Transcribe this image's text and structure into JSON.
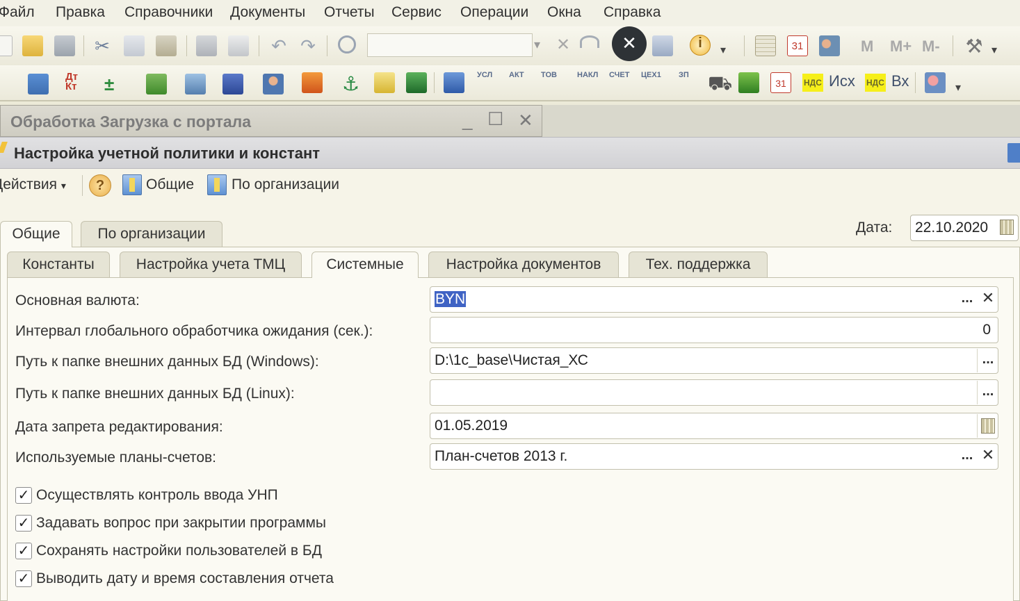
{
  "menu": [
    "Файл",
    "Правка",
    "Справочники",
    "Документы",
    "Отчеты",
    "Сервис",
    "Операции",
    "Окна",
    "Справка"
  ],
  "toolbar": {
    "memory_buttons": [
      "M",
      "M+",
      "M-"
    ],
    "doc_buttons": [
      "УСЛ",
      "АКТ",
      "ТОВ",
      "НАКЛ",
      "СЧЕТ",
      "ЦЕХ1",
      "ЗП"
    ],
    "nds_label": "НДС",
    "nds_out": "Исх",
    "nds_in": "Вх"
  },
  "docwin": {
    "title": "Обработка  Загрузка с портала"
  },
  "form": {
    "title": "Настройка учетной политики и констант",
    "actions_label": "Действия",
    "general_label": "Общие",
    "by_org_label": "По организации",
    "date_label": "Дата:",
    "date_value": "22.10.2020",
    "top_tabs": [
      "Общие",
      "По организации"
    ],
    "sub_tabs": [
      "Константы",
      "Настройка учета ТМЦ",
      "Системные",
      "Настройка документов",
      "Тех. поддержка"
    ]
  },
  "fields": {
    "currency": {
      "label": "Основная валюта:",
      "value": "BYN"
    },
    "interval": {
      "label": "Интервал глобального обработчика ожидания (сек.):",
      "value": "0"
    },
    "path_windows": {
      "label": "Путь к папке внешних данных БД (Windows):",
      "value": "D:\\1c_base\\Чистая_ХС"
    },
    "path_linux": {
      "label": "Путь к папке внешних данных БД (Linux):",
      "value": ""
    },
    "edit_ban_date": {
      "label": "Дата запрета редактирования:",
      "value": "01.05.2019"
    },
    "charts_of_accounts": {
      "label": "Используемые планы-счетов:",
      "value": "План-счетов 2013 г."
    }
  },
  "checkboxes": [
    {
      "label": "Осуществлять контроль ввода УНП",
      "checked": true
    },
    {
      "label": "Задавать вопрос при закрытии программы",
      "checked": true
    },
    {
      "label": "Сохранять настройки пользователей в БД",
      "checked": true
    },
    {
      "label": "Выводить дату и время составления отчета",
      "checked": true
    }
  ],
  "ui": {
    "ellipsis": "...",
    "clear": "✕",
    "close_overlay": "✕",
    "check_mark": "✓",
    "dropdown": "▾",
    "question": "?"
  },
  "colors": {
    "selection": "#3f63c4",
    "nds_badge": "#f6ef1a",
    "form_background": "#fbfaf3",
    "title_bar": "#d2d2d5"
  }
}
